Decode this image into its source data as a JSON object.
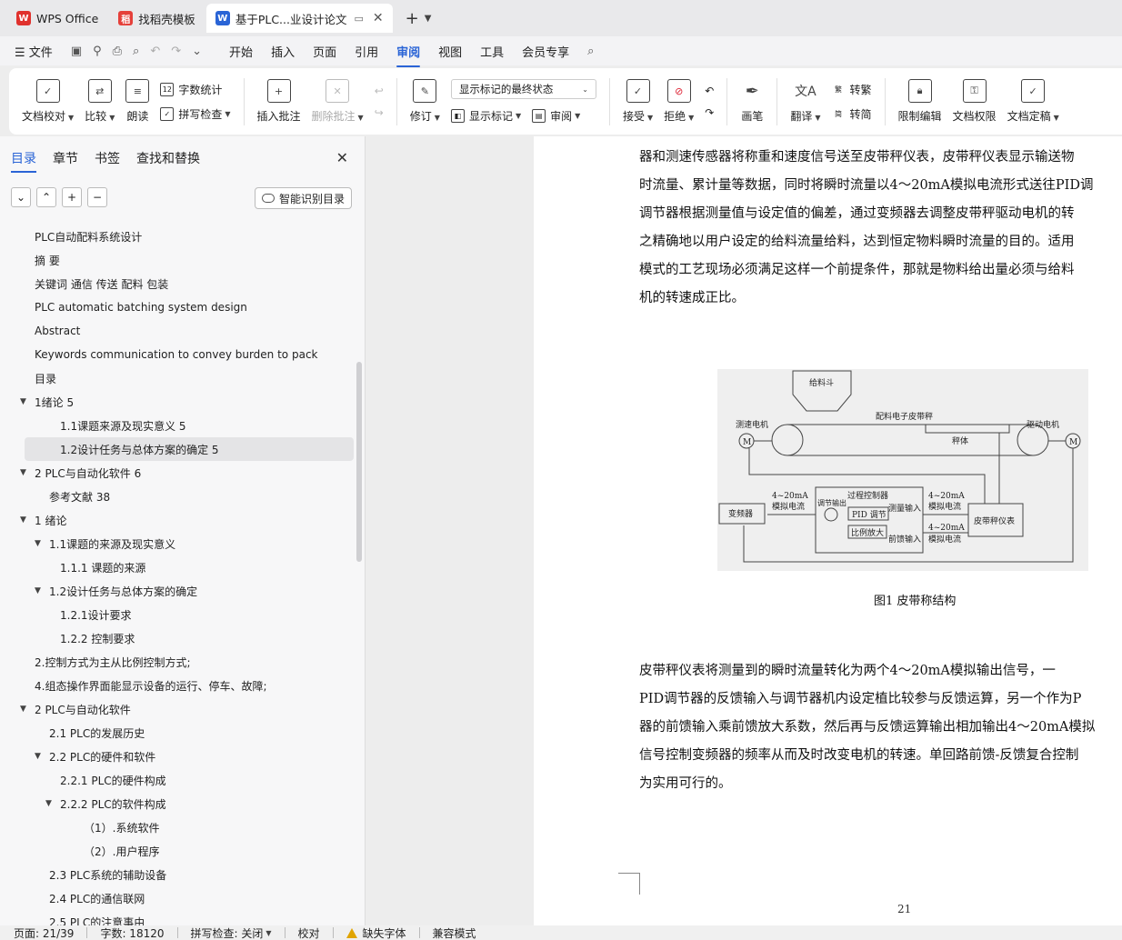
{
  "tabs": [
    {
      "label": "WPS Office",
      "logo": "W",
      "logo_color": "#e0312d"
    },
    {
      "label": "找稻壳模板",
      "logo": "稻",
      "logo_color": "#e5403a"
    },
    {
      "label": "基于PLC...业设计论文",
      "logo": "W",
      "logo_color": "#2a64d6"
    }
  ],
  "menubar": {
    "file": "文件",
    "items": [
      "开始",
      "插入",
      "页面",
      "引用",
      "审阅",
      "视图",
      "工具",
      "会员专享"
    ],
    "active": "审阅"
  },
  "ribbon": {
    "doc_check": "文档校对",
    "compare": "比较",
    "read_aloud": "朗读",
    "word_count": "字数统计",
    "spell_check": "拼写检查",
    "insert_comment": "插入批注",
    "delete_comment": "删除批注",
    "revise": "修订",
    "markup_state": "显示标记的最终状态",
    "show_markup": "显示标记",
    "review": "审阅",
    "accept": "接受",
    "reject": "拒绝",
    "pen": "画笔",
    "translate": "翻译",
    "to_traditional": "转繁",
    "to_simplified": "转简",
    "restrict_edit": "限制编辑",
    "doc_permission": "文档权限",
    "doc_finalize": "文档定稿",
    "word_count_icon": "12"
  },
  "nav": {
    "tabs": [
      "目录",
      "章节",
      "书签",
      "查找和替换"
    ],
    "smart_toc": "智能识别目录",
    "toc": [
      {
        "text": "PLC自动配料系统设计",
        "level": 0,
        "caret": ""
      },
      {
        "text": "摘    要",
        "level": 0,
        "caret": ""
      },
      {
        "text": "关键词  通信  传送  配料  包装",
        "level": 0,
        "caret": ""
      },
      {
        "text": "PLC automatic batching system design",
        "level": 0,
        "caret": ""
      },
      {
        "text": "Abstract",
        "level": 0,
        "caret": ""
      },
      {
        "text": "Keywords communication to convey burden to pack",
        "level": 0,
        "caret": ""
      },
      {
        "text": "目录",
        "level": 0,
        "caret": ""
      },
      {
        "text": "1绪论  5",
        "level": 0,
        "caret": "▼"
      },
      {
        "text": "1.1课题来源及现实意义  5",
        "level": 2,
        "caret": ""
      },
      {
        "text": "1.2设计任务与总体方案的确定  5",
        "level": 2,
        "caret": "",
        "selected": true
      },
      {
        "text": "2 PLC与自动化软件  6",
        "level": 0,
        "caret": "▼"
      },
      {
        "text": "参考文献  38",
        "level": 1,
        "caret": ""
      },
      {
        "text": "1  绪论",
        "level": 0,
        "caret": "▼"
      },
      {
        "text": "1.1课题的来源及现实意义",
        "level": 1,
        "caret": "▼"
      },
      {
        "text": "1.1.1  课题的来源",
        "level": 2,
        "caret": ""
      },
      {
        "text": "1.2设计任务与总体方案的确定",
        "level": 1,
        "caret": "▼"
      },
      {
        "text": "1.2.1设计要求",
        "level": 2,
        "caret": ""
      },
      {
        "text": "1.2.2  控制要求",
        "level": 2,
        "caret": ""
      },
      {
        "text": "2.控制方式为主从比例控制方式;",
        "level": 0,
        "caret": ""
      },
      {
        "text": "4.组态操作界面能显示设备的运行、停车、故障;",
        "level": 0,
        "caret": ""
      },
      {
        "text": "2 PLC与自动化软件",
        "level": 0,
        "caret": "▼"
      },
      {
        "text": "2.1 PLC的发展历史",
        "level": 1,
        "caret": ""
      },
      {
        "text": "2.2 PLC的硬件和软件",
        "level": 1,
        "caret": "▼"
      },
      {
        "text": "2.2.1 PLC的硬件构成",
        "level": 2,
        "caret": ""
      },
      {
        "text": "2.2.2 PLC的软件构成",
        "level": 2,
        "caret": "▼"
      },
      {
        "text": "（1）.系统软件",
        "level": 3,
        "caret": ""
      },
      {
        "text": "（2）.用户程序",
        "level": 3,
        "caret": ""
      },
      {
        "text": "2.3 PLC系统的辅助设备",
        "level": 1,
        "caret": ""
      },
      {
        "text": "2.4 PLC的通信联网",
        "level": 1,
        "caret": ""
      },
      {
        "text": "2.5 PLC的注意事由",
        "level": 1,
        "caret": ""
      }
    ]
  },
  "document": {
    "para1": [
      "器和测速传感器将称重和速度信号送至皮带秤仪表，皮带秤仪表显示输送物",
      "时流量、累计量等数据，同时将瞬时流量以4～20mA模拟电流形式送往PID调",
      "调节器根据测量值与设定值的偏差，通过变频器去调整皮带秤驱动电机的转",
      "之精确地以用户设定的给料流量给料，达到恒定物料瞬时流量的目的。适用",
      "模式的工艺现场必须满足这样一个前提条件，那就是物料给出量必须与给料",
      "机的转速成正比。"
    ],
    "para2": [
      "        皮带秤仪表将测量到的瞬时流量转化为两个4～20mA模拟输出信号，一",
      "PID调节器的反馈输入与调节器机内设定植比较参与反馈运算，另一个作为P",
      "器的前馈输入乘前馈放大系数，然后再与反馈运算输出相加输出4～20mA模拟",
      "信号控制变频器的频率从而及时改变电机的转速。单回路前馈-反馈复合控制",
      "为实用可行的。"
    ],
    "figure": {
      "hopper": "给料斗",
      "belt": "配料电子皮带秤",
      "speed_motor": "测速电机",
      "drive_motor": "驱动电机",
      "scale_body": "秤体",
      "motor_symbol": "M",
      "controller": "过程控制器",
      "adjust_out": "调节输出",
      "pid": "PID 调节",
      "measure_in": "测量输入",
      "ratio_amp": "比例放大",
      "feedforward_in": "前馈输入",
      "current_left_1": "4~20mA",
      "current_left_2": "模拟电流",
      "current_right_1": "4~20mA",
      "current_right_2": "模拟电流",
      "current_right_3": "4~20mA",
      "current_right_4": "模拟电流",
      "inverter": "变频器",
      "scale_meter": "皮带秤仪表"
    },
    "caption": "图1  皮带称结构",
    "page_number": "21"
  },
  "status": {
    "page": "页面: 21/39",
    "words": "字数: 18120",
    "spell": "拼写检查: 关闭",
    "proof": "校对",
    "missing_font": "缺失字体",
    "compat": "兼容模式"
  }
}
